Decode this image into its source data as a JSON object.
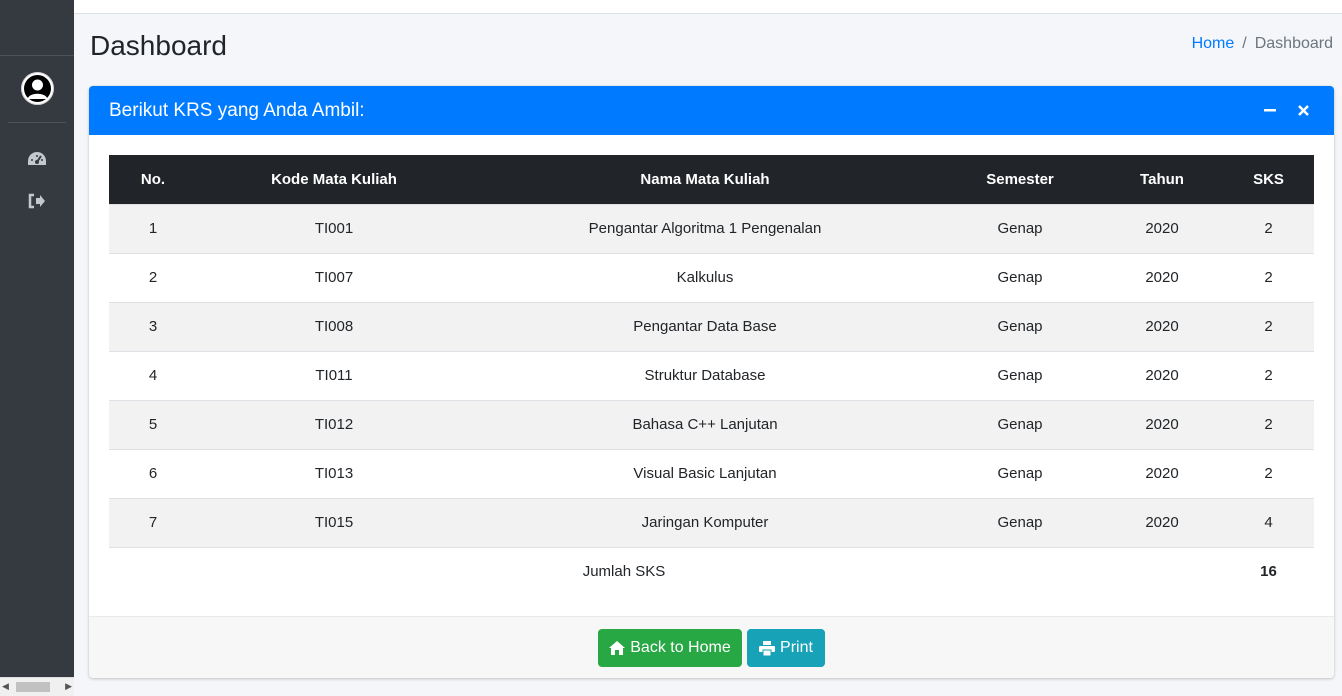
{
  "page": {
    "title": "Dashboard"
  },
  "breadcrumb": {
    "home": "Home",
    "separator": "/",
    "current": "Dashboard"
  },
  "sidebar": {
    "icons": [
      "dashboard-icon",
      "logout-icon"
    ]
  },
  "card": {
    "title": "Berikut KRS yang Anda Ambil:",
    "tools": [
      "minimize-icon",
      "close-icon"
    ]
  },
  "table": {
    "headers": [
      "No.",
      "Kode Mata Kuliah",
      "Nama Mata Kuliah",
      "Semester",
      "Tahun",
      "SKS"
    ],
    "rows": [
      [
        "1",
        "TI001",
        "Pengantar Algoritma 1 Pengenalan",
        "Genap",
        "2020",
        "2"
      ],
      [
        "2",
        "TI007",
        "Kalkulus",
        "Genap",
        "2020",
        "2"
      ],
      [
        "3",
        "TI008",
        "Pengantar Data Base",
        "Genap",
        "2020",
        "2"
      ],
      [
        "4",
        "TI011",
        "Struktur Database",
        "Genap",
        "2020",
        "2"
      ],
      [
        "5",
        "TI012",
        "Bahasa C++ Lanjutan",
        "Genap",
        "2020",
        "2"
      ],
      [
        "6",
        "TI013",
        "Visual Basic Lanjutan",
        "Genap",
        "2020",
        "2"
      ],
      [
        "7",
        "TI015",
        "Jaringan Komputer",
        "Genap",
        "2020",
        "4"
      ]
    ],
    "total_label": "Jumlah SKS",
    "total_value": "16"
  },
  "footer": {
    "back_label": "Back to Home",
    "print_label": "Print"
  },
  "colors": {
    "primary": "#007bff",
    "success": "#28a745",
    "info": "#17a2b8",
    "sidebar": "#343a40",
    "table_head": "#212529"
  }
}
